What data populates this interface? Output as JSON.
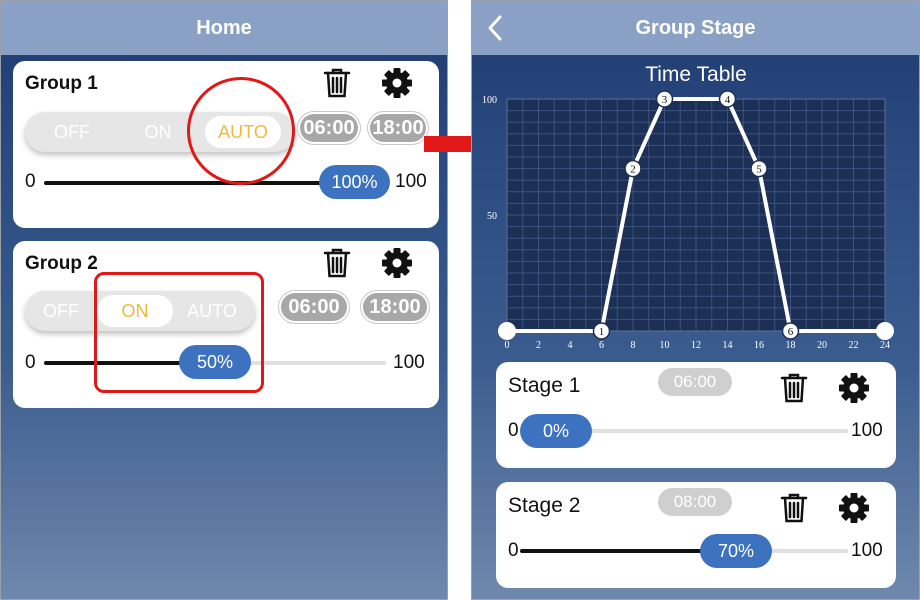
{
  "home": {
    "title": "Home",
    "groups": [
      {
        "name": "Group 1",
        "modes": [
          "OFF",
          "ON",
          "AUTO"
        ],
        "active_mode": "AUTO",
        "start_time": "06:00",
        "end_time": "18:00",
        "slider_min": "0",
        "slider_max": "100",
        "value_label": "100%",
        "value": 1.0
      },
      {
        "name": "Group 2",
        "modes": [
          "OFF",
          "ON",
          "AUTO"
        ],
        "active_mode": "ON",
        "start_time": "06:00",
        "end_time": "18:00",
        "slider_min": "0",
        "slider_max": "100",
        "value_label": "50%",
        "value": 0.5
      }
    ]
  },
  "group_stage": {
    "title": "Group Stage",
    "stages": [
      {
        "name": "Stage 1",
        "time": "06:00",
        "slider_min": "0",
        "slider_max": "100",
        "value_label": "0%",
        "value": 0.0
      },
      {
        "name": "Stage 2",
        "time": "08:00",
        "slider_min": "0",
        "slider_max": "100",
        "value_label": "70%",
        "value": 0.7
      }
    ]
  },
  "chart_data": {
    "type": "line",
    "title": "Time Table",
    "xlabel": "",
    "ylabel": "",
    "xlim": [
      0,
      24
    ],
    "ylim": [
      0,
      100
    ],
    "x_ticks": [
      "0",
      "2",
      "4",
      "6",
      "8",
      "10",
      "12",
      "14",
      "16",
      "18",
      "20",
      "22",
      "24"
    ],
    "y_ticks": [
      "50",
      "100"
    ],
    "grid": true,
    "series": [
      {
        "points": [
          {
            "x": 0,
            "y": 0,
            "label": ""
          },
          {
            "x": 6,
            "y": 0,
            "label": "1"
          },
          {
            "x": 8,
            "y": 70,
            "label": "2"
          },
          {
            "x": 10,
            "y": 100,
            "label": "3"
          },
          {
            "x": 14,
            "y": 100,
            "label": "4"
          },
          {
            "x": 16,
            "y": 70,
            "label": "5"
          },
          {
            "x": 18,
            "y": 0,
            "label": "6"
          },
          {
            "x": 24,
            "y": 0,
            "label": ""
          }
        ]
      }
    ],
    "colors": {
      "plot_background": "#1c2f55",
      "grid": "#3c5280",
      "line": "#ffffff"
    }
  },
  "colors": {
    "navbar": "#8aa0c4",
    "accent_blue": "#3c72c0",
    "auto_active": "#f0b93a",
    "highlight_red": "#e01818",
    "time_pill": "#a8a8a8"
  },
  "icons": [
    "back-chevron-icon",
    "trash-icon",
    "gear-icon",
    "arrow-right-icon"
  ]
}
